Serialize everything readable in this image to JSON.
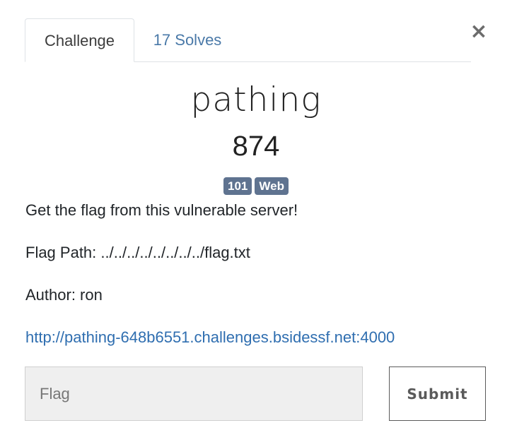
{
  "modal": {
    "close_glyph": "×",
    "tabs": [
      {
        "label": "Challenge",
        "active": true
      },
      {
        "label": "17 Solves",
        "active": false
      }
    ],
    "challenge": {
      "name": "pathing",
      "points": "874",
      "tags": [
        "101",
        "Web"
      ],
      "description": {
        "line1": "Get the flag from this vulnerable server!",
        "line2": "Flag Path: ../../../../../../../../flag.txt",
        "line3": "Author: ron",
        "link": "http://pathing-648b6551.challenges.bsidessf.net:4000"
      }
    },
    "form": {
      "flag_placeholder": "Flag",
      "flag_value": "",
      "submit_label": "Submit"
    }
  },
  "colors": {
    "tag_bg": "#5f7390",
    "link": "#2f6eb0",
    "tab_inactive": "#4a79a8"
  }
}
